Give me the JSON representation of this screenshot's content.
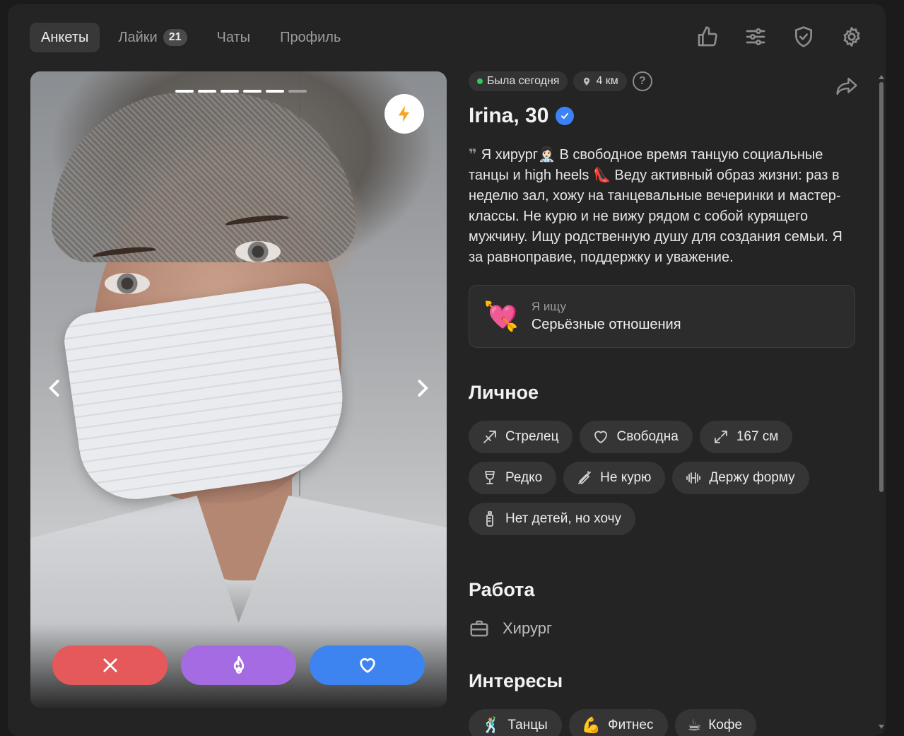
{
  "nav": {
    "tabs": [
      {
        "label": "Анкеты",
        "active": true
      },
      {
        "label": "Лайки",
        "badge": "21"
      },
      {
        "label": "Чаты"
      },
      {
        "label": "Профиль"
      }
    ],
    "icons": [
      "thumbs-up-icon",
      "sliders-icon",
      "shield-check-icon",
      "gear-icon"
    ]
  },
  "photo": {
    "indicator_total": 6,
    "indicator_active": 5,
    "boost_icon": "lightning-icon",
    "actions": [
      {
        "name": "dislike",
        "icon": "close-icon",
        "color": "#e5595a"
      },
      {
        "name": "superlike",
        "icon": "flame-icon",
        "color": "#a56be3"
      },
      {
        "name": "like",
        "icon": "heart-icon",
        "color": "#3e84f0"
      }
    ]
  },
  "profile": {
    "status": "Была сегодня",
    "distance": "4 км",
    "help": "?",
    "name": "Irina, 30",
    "verified": true,
    "bio": "Я хирург👩🏻‍⚕️ В свободное время танцую социальные танцы и high heels 👠 Веду активный образ жизни: раз в неделю зал, хожу на танцевальные вечеринки и мастер-классы. Не курю и не вижу рядом с собой курящего мужчину. Ищу родственную душу для создания семьи. Я за равноправие, поддержку и уважение.",
    "looking_for": {
      "icon": "💘",
      "label": "Я ищу",
      "value": "Серьёзные отношения"
    }
  },
  "personal": {
    "title": "Личное",
    "tags": [
      {
        "label": "Стрелец",
        "icon": "sagittarius-icon"
      },
      {
        "label": "Свободна",
        "icon": "heart-outline-icon"
      },
      {
        "label": "167 см",
        "icon": "resize-icon"
      },
      {
        "label": "Редко",
        "icon": "wine-glass-icon"
      },
      {
        "label": "Не курю",
        "icon": "no-smoking-icon"
      },
      {
        "label": "Держу форму",
        "icon": "dumbbell-icon"
      },
      {
        "label": "Нет детей, но хочу",
        "icon": "baby-bottle-icon"
      }
    ]
  },
  "work": {
    "title": "Работа",
    "value": "Хирург",
    "icon": "briefcase-icon"
  },
  "interests": {
    "title": "Интересы",
    "items": [
      {
        "emoji": "🕺",
        "label": "Танцы"
      },
      {
        "emoji": "💪",
        "label": "Фитнес"
      },
      {
        "emoji": "☕",
        "label": "Кофе"
      }
    ]
  }
}
